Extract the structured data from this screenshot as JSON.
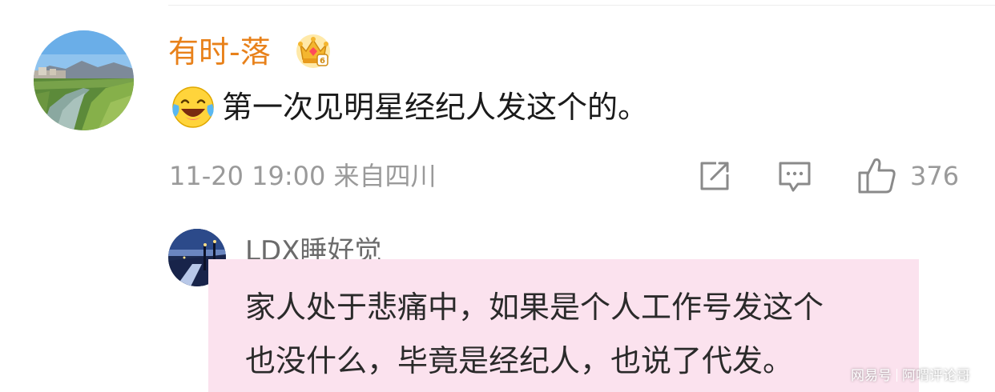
{
  "comment": {
    "author": "有时-落",
    "badge_icon": "crown-badge-icon",
    "emoji": "laughing-crying-emoji",
    "text": "第一次见明星经纪人发这个的。",
    "timestamp": "11-20 19:00  来自四川",
    "actions": {
      "share_icon": "share-icon",
      "comment_icon": "comment-icon",
      "like_icon": "thumbs-up-icon",
      "like_count": "376"
    }
  },
  "reply": {
    "author": "LDX睡好觉",
    "lines": [
      "家人处于悲痛中，如果是个人工作号发这个",
      "也没什么，毕竟是经纪人，也说了代发。"
    ],
    "highlight_color": "#fbe2ee"
  },
  "watermark": {
    "platform": "网易号",
    "account": "阿喟评论哥"
  },
  "colors": {
    "author_name": "#e8811a",
    "meta_gray": "#9a9a9a",
    "text_dark": "#1a1a1a"
  }
}
